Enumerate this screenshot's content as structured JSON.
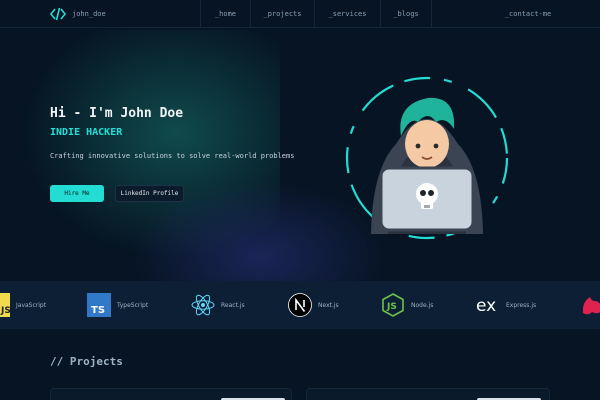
{
  "nav": {
    "logo_text": "john_doe",
    "links": [
      "_home",
      "_projects",
      "_services",
      "_blogs",
      "_contact-me"
    ]
  },
  "hero": {
    "title": "Hi - I'm John Doe",
    "subtitle": "INDIE HACKER",
    "description": "Crafting innovative solutions to solve real-world problems",
    "hire_label": "Hire Me",
    "linkedin_label": "LinkedIn Profile"
  },
  "tech": [
    {
      "name": "JavaScript",
      "icon": "javascript-icon",
      "color": "#f0db4f"
    },
    {
      "name": "TypeScript",
      "icon": "typescript-icon",
      "color": "#3178c6"
    },
    {
      "name": "React.js",
      "icon": "react-icon",
      "color": "#61dafb"
    },
    {
      "name": "Next.js",
      "icon": "nextjs-icon",
      "color": "#ffffff"
    },
    {
      "name": "Node.js",
      "icon": "nodejs-icon",
      "color": "#6cc24a"
    },
    {
      "name": "Express.js",
      "icon": "express-icon",
      "color": "#ffffff"
    },
    {
      "name": "",
      "icon": "nestjs-icon",
      "color": "#e0234e"
    }
  ],
  "projects": {
    "title": "// Projects"
  },
  "colors": {
    "accent": "#23ddd4",
    "background": "#061423"
  }
}
